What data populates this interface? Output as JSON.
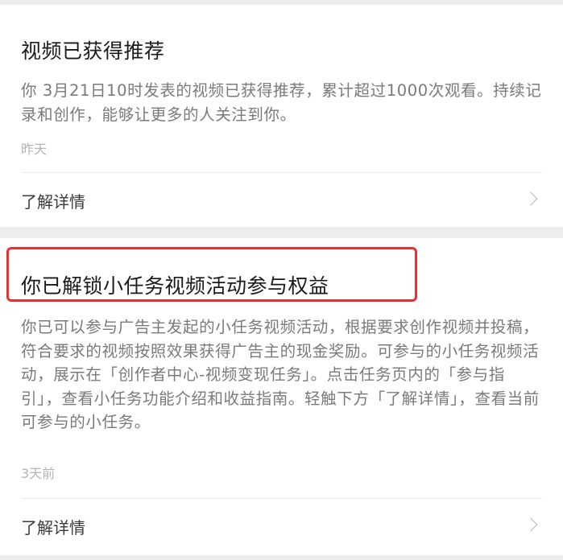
{
  "notifications": [
    {
      "title": "视频已获得推荐",
      "body": "你 3月21日10时发表的视频已获得推荐，累计超过1000次观看。持续记录和创作，能够让更多的人关注到你。",
      "time": "昨天",
      "more_label": "了解详情",
      "more_icon": "chevron-right-icon"
    },
    {
      "title": "你已解锁小任务视频活动参与权益",
      "body": "你已可以参与广告主发起的小任务视频活动，根据要求创作视频并投稿，符合要求的视频按照效果获得广告主的现金奖励。可参与的小任务视频活动，展示在「创作者中心-视频变现任务」。点击任务页内的「参与指引」，查看小任务功能介绍和收益指南。轻触下方「了解详情」，查看当前可参与的小任务。",
      "time": "3天前",
      "more_label": "了解详情",
      "more_icon": "chevron-right-icon"
    }
  ],
  "colors": {
    "page_background": "#ededed",
    "card_background": "#ffffff",
    "title_text": "#1a1a1a",
    "body_text": "#7a7a7a",
    "time_text": "#b4b4b4",
    "highlight_border": "#e8322f"
  }
}
